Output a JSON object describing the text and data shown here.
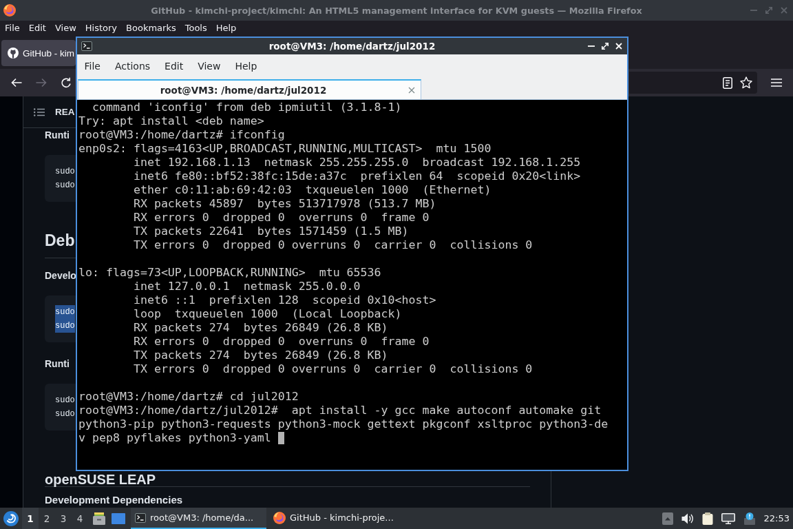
{
  "browser": {
    "window": {
      "title": "GitHub - kimchi-project/kimchi: An HTML5 management interface for KVM guests — Mozilla Firefox"
    },
    "menu": [
      "File",
      "Edit",
      "View",
      "History",
      "Bookmarks",
      "Tools",
      "Help"
    ],
    "tabs": [
      {
        "label": "GitHub - kim",
        "selected": true
      }
    ],
    "readme": {
      "header": "REA",
      "items": [
        {
          "kind": "h3",
          "text": "Runti"
        },
        {
          "kind": "code",
          "lines": [
            {
              "text": "sudo",
              "selected": false
            },
            {
              "text": "sudo",
              "selected": false
            }
          ]
        },
        {
          "kind": "h2",
          "text": "Deb"
        },
        {
          "kind": "h3",
          "text": "Develo"
        },
        {
          "kind": "code",
          "lines": [
            {
              "text": "sudo",
              "selected": true
            },
            {
              "text": "sudo",
              "selected": true
            }
          ]
        },
        {
          "kind": "h3",
          "text": "Runti"
        },
        {
          "kind": "code",
          "lines": [
            {
              "text": "sudo",
              "selected": false
            },
            {
              "text": "sudo",
              "selected": false
            }
          ]
        },
        {
          "kind": "h2",
          "text": "openSUSE LEAP"
        },
        {
          "kind": "h3",
          "text": "Development Dependencies"
        }
      ]
    }
  },
  "terminal": {
    "window": {
      "title": "root@VM3: /home/dartz/jul2012"
    },
    "menu": [
      "File",
      "Actions",
      "Edit",
      "View",
      "Help"
    ],
    "tabs": [
      {
        "label": "root@VM3: /home/dartz/jul2012",
        "selected": true
      }
    ],
    "output": [
      [
        "  command 'iconfig' from deb ipmiutil (3.1.8-1)",
        "Try: apt install <deb name>",
        "root@VM3:/home/dartz# ifconfig",
        "enp0s2: flags=4163<UP,BROADCAST,RUNNING,MULTICAST>  mtu 1500",
        "        inet 192.168.1.13  netmask 255.255.255.0  broadcast 192.168.1.255",
        "        inet6 fe80::bf52:38fc:15de:a37c  prefixlen 64  scopeid 0x20<link>",
        "        ether c0:11:ab:69:42:03  txqueuelen 1000  (Ethernet)",
        "        RX packets 45897  bytes 513717978 (513.7 MB)",
        "        RX errors 0  dropped 0  overruns 0  frame 0",
        "        TX packets 22641  bytes 1571459 (1.5 MB)",
        "        TX errors 0  dropped 0 overruns 0  carrier 0  collisions 0"
      ],
      [
        "lo: flags=73<UP,LOOPBACK,RUNNING>  mtu 65536",
        "        inet 127.0.0.1  netmask 255.0.0.0",
        "        inet6 ::1  prefixlen 128  scopeid 0x10<host>",
        "        loop  txqueuelen 1000  (Local Loopback)",
        "        RX packets 274  bytes 26849 (26.8 KB)",
        "        RX errors 0  dropped 0  overruns 0  frame 0",
        "        TX packets 274  bytes 26849 (26.8 KB)",
        "        TX errors 0  dropped 0 overruns 0  carrier 0  collisions 0"
      ],
      [
        "root@VM3:/home/dartz# cd jul2012",
        "root@VM3:/home/dartz/jul2012#  apt install -y gcc make autoconf automake git",
        "python3-pip python3-requests python3-mock gettext pkgconf xsltproc python3-de",
        "v pep8 pyflakes python3-yaml"
      ]
    ]
  },
  "taskbar": {
    "workspaces": [
      {
        "label": "1",
        "selected": true
      },
      {
        "label": "2",
        "selected": false
      },
      {
        "label": "3",
        "selected": false
      },
      {
        "label": "4",
        "selected": false
      }
    ],
    "tasks": [
      {
        "kind": "terminal",
        "label": "root@VM3: /home/da...",
        "selected": true
      },
      {
        "kind": "browser",
        "label": "GitHub - kimchi-proje...",
        "selected": false
      }
    ],
    "clock": "22:53"
  }
}
